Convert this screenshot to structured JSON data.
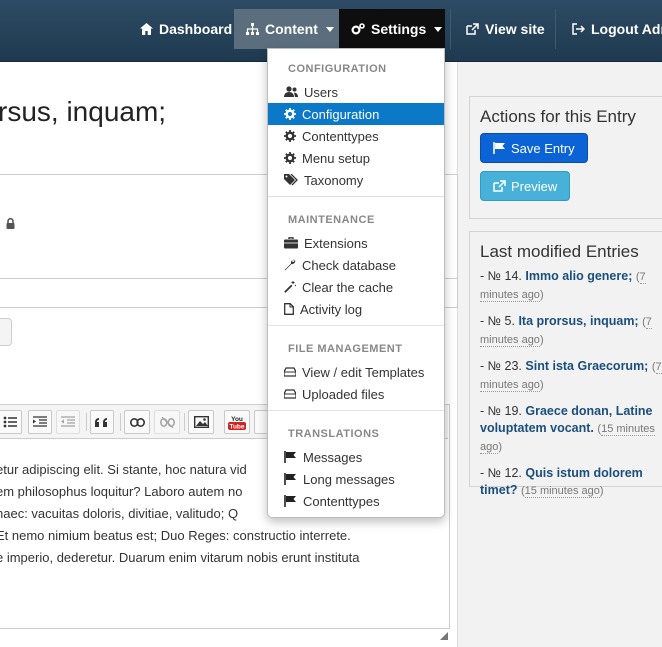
{
  "navbar": {
    "dashboard": "Dashboard",
    "content": "Content",
    "settings": "Settings",
    "view_site": "View site",
    "logout": "Logout Adm"
  },
  "entry": {
    "title": "rsus, inquam;",
    "body_lines": [
      "etur adipiscing elit. Si stante, hoc natura vid",
      "em philosophus loquitur? Laboro autem no",
      "haec: vacuitas doloris, divitiae, valitudo; Q",
      " Et nemo nimium beatus est; Duo Reges: constructio interrete.",
      "e imperio, dederetur. Duarum enim vitarum nobis erunt instituta"
    ]
  },
  "settings_menu": {
    "sections": [
      {
        "header": "CONFIGURATION",
        "items": [
          {
            "label": "Users",
            "icon": "users-icon"
          },
          {
            "label": "Configuration",
            "icon": "gear-icon"
          },
          {
            "label": "Contenttypes",
            "icon": "gear-icon"
          },
          {
            "label": "Menu setup",
            "icon": "gear-icon"
          },
          {
            "label": "Taxonomy",
            "icon": "tags-icon"
          }
        ]
      },
      {
        "header": "MAINTENANCE",
        "items": [
          {
            "label": "Extensions",
            "icon": "briefcase-icon"
          },
          {
            "label": "Check database",
            "icon": "wrench-icon"
          },
          {
            "label": "Clear the cache",
            "icon": "magic-icon"
          },
          {
            "label": "Activity log",
            "icon": "file-icon"
          }
        ]
      },
      {
        "header": "FILE MANAGEMENT",
        "items": [
          {
            "label": "View / edit Templates",
            "icon": "hdd-icon"
          },
          {
            "label": "Uploaded files",
            "icon": "hdd-icon"
          }
        ]
      },
      {
        "header": "TRANSLATIONS",
        "items": [
          {
            "label": "Messages",
            "icon": "flag-icon"
          },
          {
            "label": "Long messages",
            "icon": "flag-icon"
          },
          {
            "label": "Contenttypes",
            "icon": "flag-icon"
          }
        ]
      }
    ],
    "active_item": "Configuration"
  },
  "actions_panel": {
    "title": "Actions for this Entry",
    "save": "Save Entry",
    "preview": "Preview"
  },
  "last_modified": {
    "title": "Last modified Entries",
    "entries": [
      {
        "num": "- № 14.",
        "title": "Immo alio genere;",
        "ago_open": "(",
        "ago": "7 minutes ago",
        "ago_close": ")"
      },
      {
        "num": "- № 5.",
        "title": "Ita prorsus, inquam;",
        "ago_open": "(",
        "ago": "7 minutes ago",
        "ago_close": ")"
      },
      {
        "num": "- № 23.",
        "title": "Sint ista Graecorum;",
        "ago_open": "(",
        "ago": "7 minutes ago",
        "ago_close": ")"
      },
      {
        "num": "- № 19.",
        "title": "Graece donan, Latine voluptatem vocant.",
        "ago_open": "(",
        "ago": "15 minutes ago",
        "ago_close": ")"
      },
      {
        "num": "- № 12.",
        "title": "Quis istum dolorem timet?",
        "ago_open": "(",
        "ago": "15 minutes ago",
        "ago_close": ")"
      }
    ]
  },
  "colors": {
    "navbar": "#1f3a50",
    "menu_active": "#0b79c8",
    "primary_button": "#0b63d6",
    "info_button": "#48b1da",
    "link": "#1a4f7d"
  }
}
